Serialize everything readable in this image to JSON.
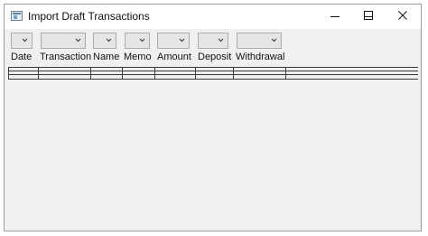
{
  "window": {
    "title": "Import Draft Transactions",
    "controls": [
      "minimize",
      "maximize",
      "close"
    ]
  },
  "columns": [
    {
      "label": "Date",
      "filter_value": ""
    },
    {
      "label": "Transaction",
      "filter_value": ""
    },
    {
      "label": "Name",
      "filter_value": ""
    },
    {
      "label": "Memo",
      "filter_value": ""
    },
    {
      "label": "Amount",
      "filter_value": ""
    },
    {
      "label": "Deposit",
      "filter_value": ""
    },
    {
      "label": "Withdrawal",
      "filter_value": ""
    }
  ],
  "rows": [
    {
      "cells": [
        "",
        "",
        "",
        "",
        "",
        "",
        ""
      ]
    },
    {
      "cells": [
        "",
        "",
        "",
        "",
        "",
        "",
        ""
      ]
    }
  ],
  "colors": {
    "window_bg": "#f0f0f0",
    "titlebar_bg": "#ffffff",
    "grid_line": "#3a3a3a"
  }
}
